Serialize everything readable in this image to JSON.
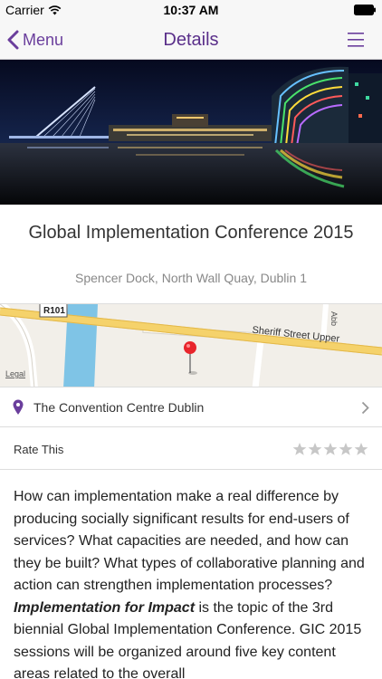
{
  "status_bar": {
    "carrier": "Carrier",
    "time": "10:37 AM"
  },
  "nav": {
    "back_label": "Menu",
    "title": "Details",
    "accent_color": "#6a3e9c"
  },
  "event": {
    "title": "Global Implementation Conference 2015",
    "address": "Spencer Dock, North Wall Quay, Dublin 1"
  },
  "map": {
    "road_r101": "R101",
    "street_sheriff": "Sheriff Street Upper",
    "street_abbey": "Abb",
    "legal": "Legal"
  },
  "venue": {
    "name": "The Convention Centre Dublin",
    "icon": "location-pin-icon"
  },
  "rating": {
    "label": "Rate This",
    "stars_total": 5,
    "stars_selected": 0
  },
  "description": {
    "part1": "How can implementation make a real difference by producing socially significant results for end-users of services? What capacities are needed, and how can they be built? What types of collaborative planning and action can strengthen implementation processes? ",
    "emphasis": "Implementation for Impact",
    "part2": " is the topic of the 3rd biennial Global Implementation Conference. GIC 2015 sessions will be organized around five key content areas related to the overall"
  }
}
